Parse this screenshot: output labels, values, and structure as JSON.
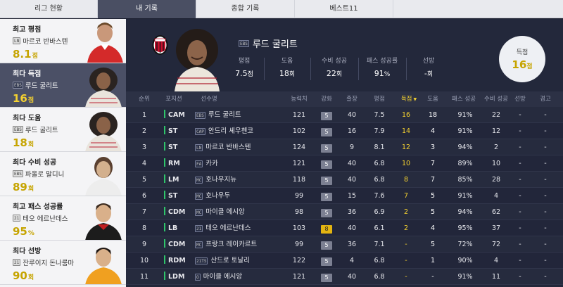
{
  "tabs": [
    "리그 현황",
    "내 기록",
    "종합 기록",
    "베스트11"
  ],
  "sidebar": {
    "cards": [
      {
        "title": "최고 평점",
        "badge": "LN",
        "name": "마르코 반바스텐",
        "value": "8.1",
        "unit": "점",
        "portrait": "van-basten-portrait"
      },
      {
        "title": "최다 득점",
        "badge": "EBS",
        "name": "루드 굴리트",
        "value": "16",
        "unit": "점",
        "portrait": "gullit-portrait"
      },
      {
        "title": "최다 도움",
        "badge": "EBS",
        "name": "루드 굴리트",
        "value": "18",
        "unit": "회",
        "portrait": "gullit-portrait"
      },
      {
        "title": "최다 수비 성공",
        "badge": "EBS",
        "name": "파올로 말디니",
        "value": "89",
        "unit": "회",
        "portrait": "maldini-portrait"
      },
      {
        "title": "최고 패스 성공률",
        "badge": "21",
        "name": "테오 에르난데스",
        "value": "95",
        "unit": "%",
        "portrait": "theo-portrait"
      },
      {
        "title": "최다 선방",
        "badge": "21",
        "name": "잔루이지 돈나룸마",
        "value": "90",
        "unit": "회",
        "portrait": "donnarumma-portrait"
      }
    ]
  },
  "hero": {
    "badge": "EBS",
    "name": "루드 굴리트",
    "stats": [
      {
        "label": "평점",
        "value": "7.5",
        "unit": "점"
      },
      {
        "label": "도움",
        "value": "18",
        "unit": "회"
      },
      {
        "label": "수비 성공",
        "value": "22",
        "unit": "회"
      },
      {
        "label": "패스 성공률",
        "value": "91",
        "unit": "%"
      },
      {
        "label": "선방",
        "value": "-",
        "unit": "회"
      }
    ],
    "goals_label": "득점",
    "goals_value": "16",
    "goals_unit": "점"
  },
  "table": {
    "headers": [
      "순위",
      "포지션",
      "선수명",
      "능력치",
      "강화",
      "출장",
      "평점",
      "득점",
      "도움",
      "패스 성공",
      "수비 성공",
      "선방",
      "경고"
    ],
    "rows": [
      {
        "rank": "1",
        "pos": "CAM",
        "badge": "EBS",
        "name": "루드 굴리트",
        "ovr": "121",
        "upg": "5",
        "apps": "40",
        "rating": "7.5",
        "goals": "16",
        "assists": "18",
        "pass": "91%",
        "def": "22",
        "save": "-",
        "warn": "-"
      },
      {
        "rank": "2",
        "pos": "ST",
        "badge": "CAP",
        "name": "안드리 셰우첸코",
        "ovr": "102",
        "upg": "5",
        "apps": "16",
        "rating": "7.9",
        "goals": "14",
        "assists": "4",
        "pass": "91%",
        "def": "12",
        "save": "-",
        "warn": "-"
      },
      {
        "rank": "3",
        "pos": "ST",
        "badge": "LN",
        "name": "마르코 반바스텐",
        "ovr": "124",
        "upg": "5",
        "apps": "9",
        "rating": "8.1",
        "goals": "12",
        "assists": "3",
        "pass": "94%",
        "def": "2",
        "save": "-",
        "warn": "-"
      },
      {
        "rank": "4",
        "pos": "RM",
        "badge": "FA",
        "name": "카카",
        "ovr": "121",
        "upg": "5",
        "apps": "40",
        "rating": "6.8",
        "goals": "10",
        "assists": "7",
        "pass": "89%",
        "def": "10",
        "save": "-",
        "warn": "-"
      },
      {
        "rank": "5",
        "pos": "LM",
        "badge": "MC",
        "name": "호나우지뉴",
        "ovr": "118",
        "upg": "5",
        "apps": "40",
        "rating": "6.8",
        "goals": "8",
        "assists": "7",
        "pass": "85%",
        "def": "28",
        "save": "-",
        "warn": "-"
      },
      {
        "rank": "6",
        "pos": "ST",
        "badge": "MC",
        "name": "호나우두",
        "ovr": "99",
        "upg": "5",
        "apps": "15",
        "rating": "7.6",
        "goals": "7",
        "assists": "5",
        "pass": "91%",
        "def": "4",
        "save": "-",
        "warn": "-"
      },
      {
        "rank": "7",
        "pos": "CDM",
        "badge": "MC",
        "name": "마이클 에시앙",
        "ovr": "98",
        "upg": "5",
        "apps": "36",
        "rating": "6.9",
        "goals": "2",
        "assists": "5",
        "pass": "94%",
        "def": "62",
        "save": "-",
        "warn": "-"
      },
      {
        "rank": "8",
        "pos": "LB",
        "badge": "21",
        "name": "테오 에르난데스",
        "ovr": "103",
        "upg": "8",
        "apps": "40",
        "rating": "6.1",
        "goals": "2",
        "assists": "4",
        "pass": "95%",
        "def": "37",
        "save": "-",
        "warn": "-"
      },
      {
        "rank": "9",
        "pos": "CDM",
        "badge": "MC",
        "name": "프랑크 레이카르트",
        "ovr": "99",
        "upg": "5",
        "apps": "36",
        "rating": "7.1",
        "goals": "-",
        "assists": "5",
        "pass": "72%",
        "def": "72",
        "save": "-",
        "warn": "-"
      },
      {
        "rank": "10",
        "pos": "RDM",
        "badge": "21TS",
        "name": "산드로 토날리",
        "ovr": "122",
        "upg": "5",
        "apps": "4",
        "rating": "6.8",
        "goals": "-",
        "assists": "1",
        "pass": "90%",
        "def": "4",
        "save": "-",
        "warn": "-"
      },
      {
        "rank": "11",
        "pos": "LDM",
        "badge": "O",
        "name": "마이클 에시앙",
        "ovr": "121",
        "upg": "5",
        "apps": "40",
        "rating": "6.8",
        "goals": "-",
        "assists": "-",
        "pass": "91%",
        "def": "11",
        "save": "-",
        "warn": "-"
      }
    ]
  },
  "colors": {
    "accent": "#f5d230",
    "position_bar": "#2fc46a",
    "gold_upgrade": "#e3b411"
  }
}
